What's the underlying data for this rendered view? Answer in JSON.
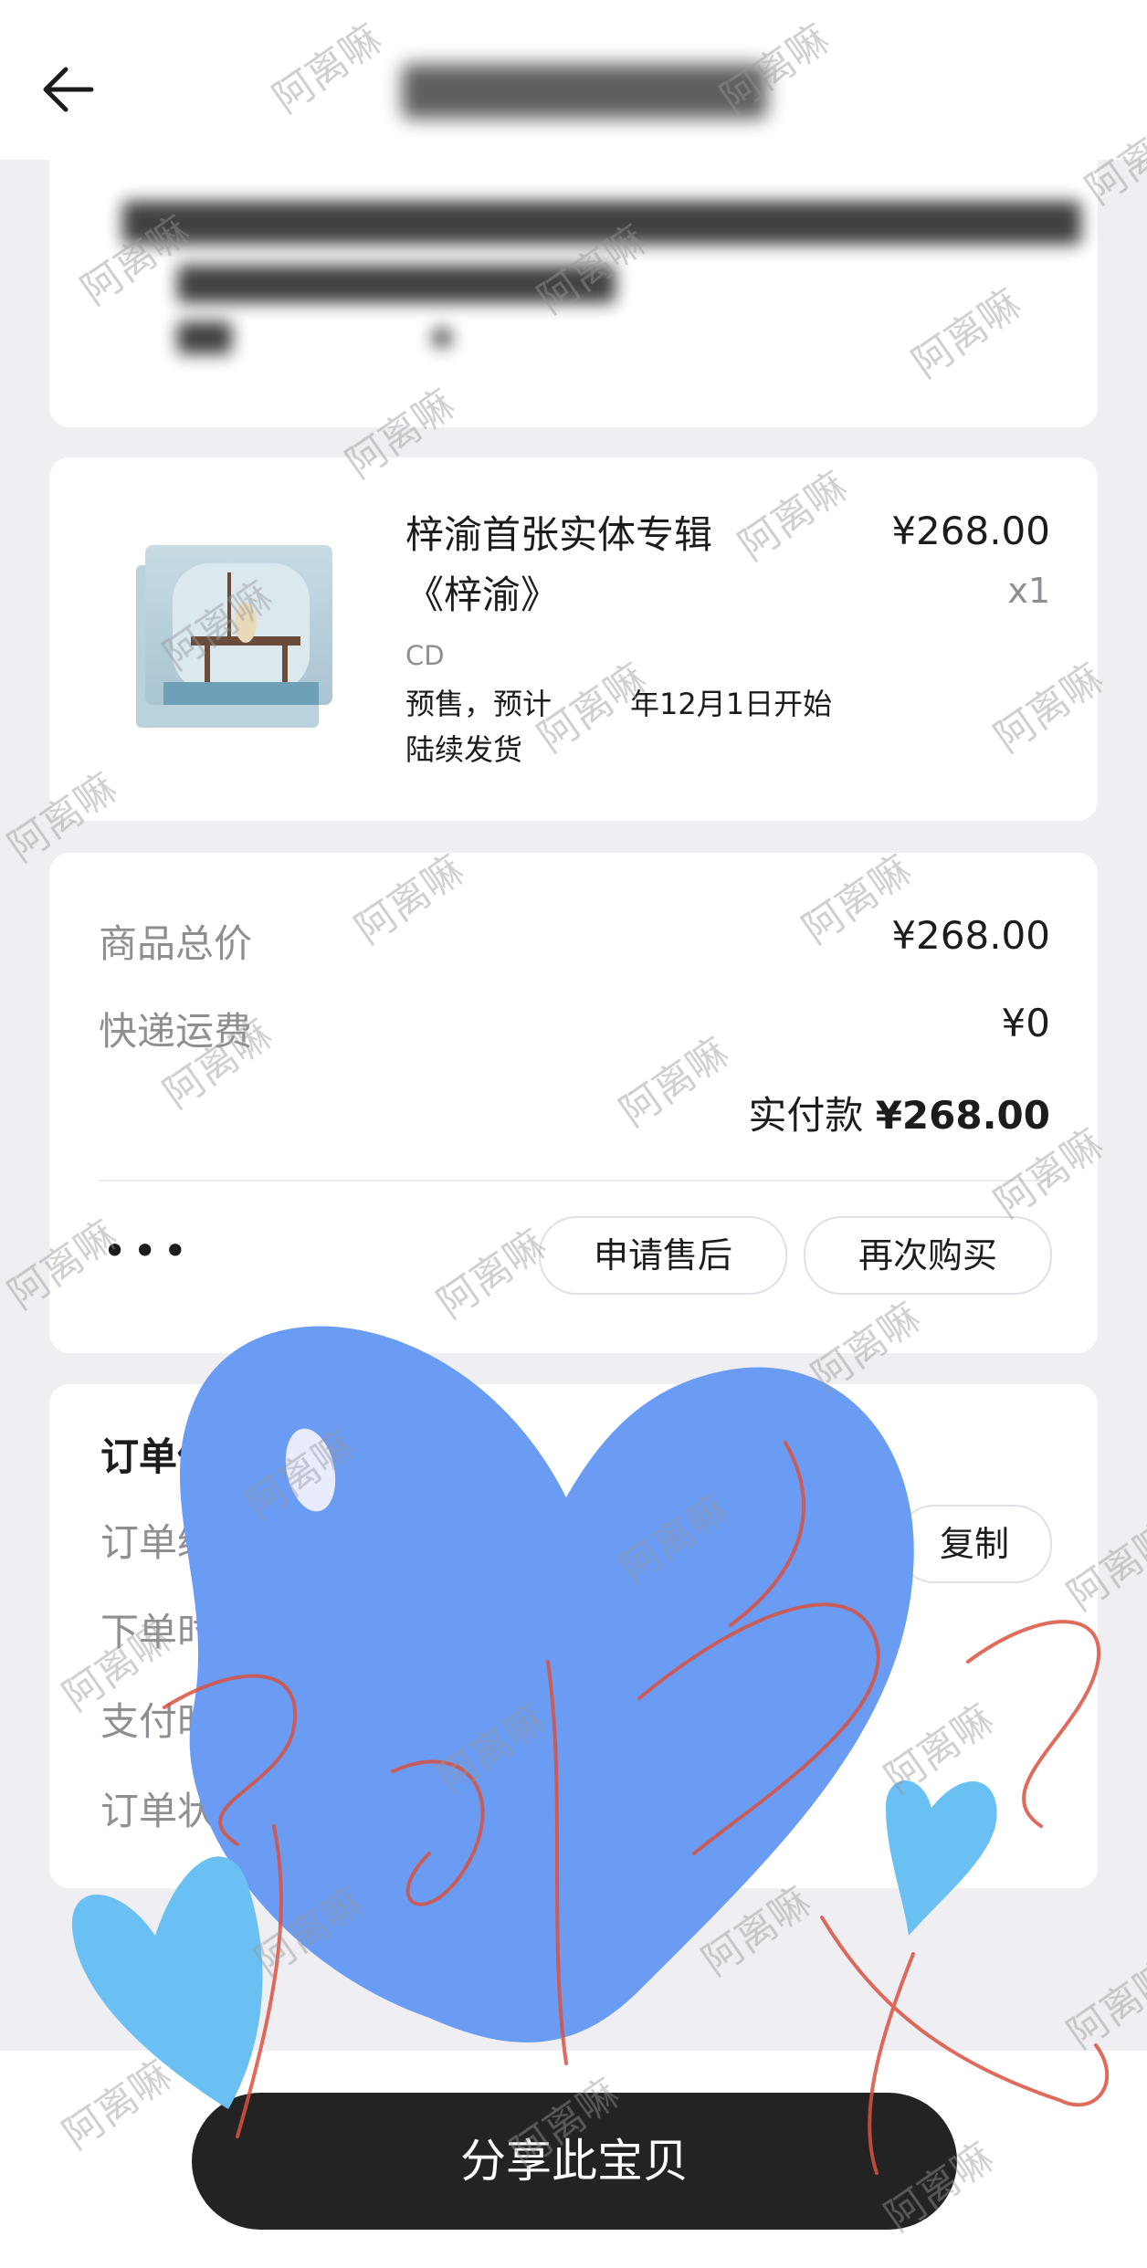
{
  "product": {
    "title_line1": "梓渝首张实体专辑",
    "title_line2": "《梓渝》",
    "price": "¥268.00",
    "qty": "x1",
    "sku": "CD",
    "note_line1": "预售，预计",
    "note_line1b": "年12月1日开始",
    "note_line2": "陆续发货"
  },
  "summary": {
    "goods_total_label": "商品总价",
    "goods_total_value": "¥268.00",
    "shipping_label": "快递运费",
    "shipping_value": "¥0",
    "actual_label": "实付款",
    "actual_value": "¥268.00",
    "more": "•••",
    "after_sale_button": "申请售后",
    "rebuy_button": "再次购买"
  },
  "order_info": {
    "title": "订单信",
    "order_no_label": "订单编",
    "order_time_label": "下单时",
    "pay_time_label": "支付时间",
    "status_label": "订单状态",
    "copy_button": "复制"
  },
  "bottom": {
    "share_button": "分享此宝贝"
  },
  "watermark": "阿离嘛",
  "colors": {
    "heart_big": "#6b9cf3",
    "heart_small": "#6ac0f2",
    "scribble": "#d9513f"
  }
}
